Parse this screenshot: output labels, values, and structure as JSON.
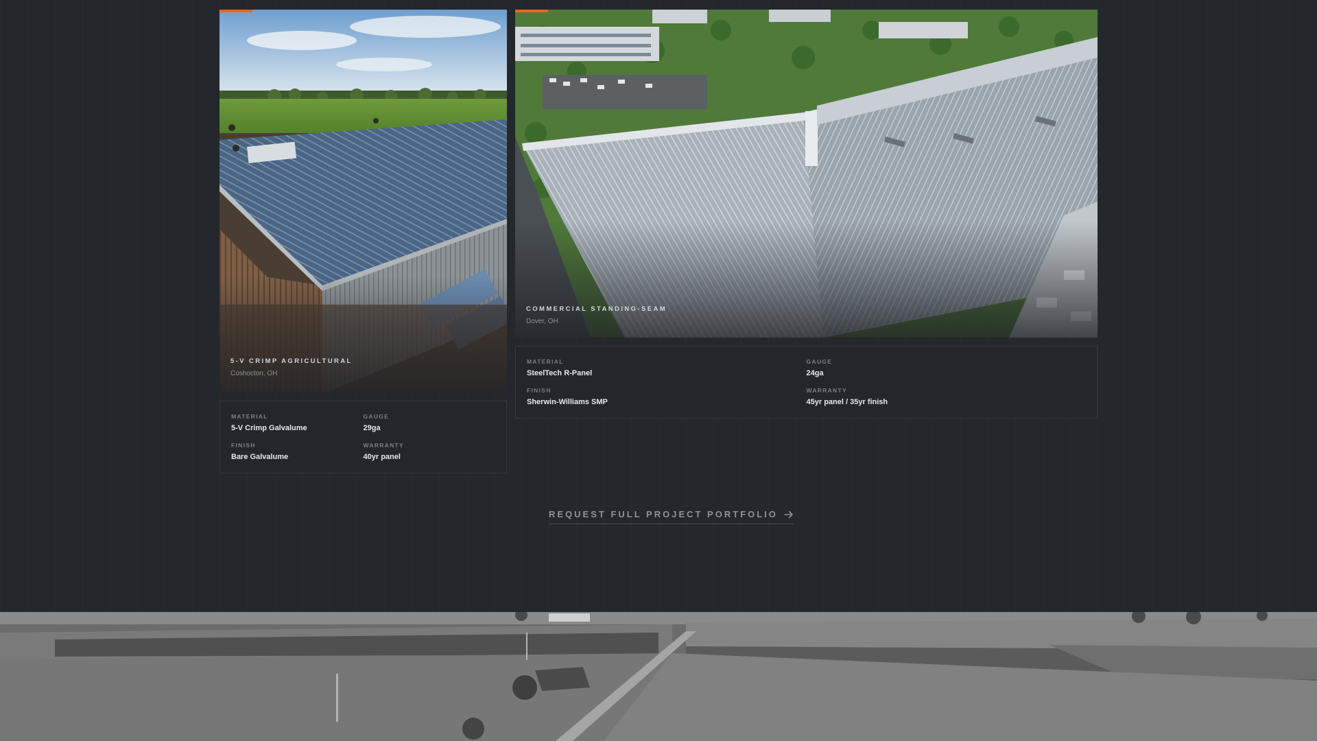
{
  "projects": [
    {
      "title": "5-V Crimp Agricultural",
      "location": "Coshocton, OH",
      "image": "metal-roofed-barn-aerial-photo",
      "specs": [
        {
          "label": "Material",
          "value": "5-V Crimp Galvalume"
        },
        {
          "label": "Gauge",
          "value": "29ga"
        },
        {
          "label": "Finish",
          "value": "Bare Galvalume"
        },
        {
          "label": "Warranty",
          "value": "40yr panel"
        }
      ]
    },
    {
      "title": "Commercial Standing-Seam",
      "location": "Dover, OH",
      "image": "commercial-warehouse-roof-aerial-photo",
      "specs": [
        {
          "label": "Material",
          "value": "SteelTech R-Panel"
        },
        {
          "label": "Gauge",
          "value": "24ga"
        },
        {
          "label": "Finish",
          "value": "Sherwin-Williams SMP"
        },
        {
          "label": "Warranty",
          "value": "45yr panel / 35yr finish"
        }
      ]
    }
  ],
  "cta": {
    "label": "Request Full Project Portfolio",
    "icon": "arrow-right-icon"
  },
  "footer": {
    "image": "farmland-aerial-grayscale-photo"
  },
  "colors": {
    "background": "#24272c",
    "accent": "#e8671c",
    "card_border": "#34383e"
  }
}
